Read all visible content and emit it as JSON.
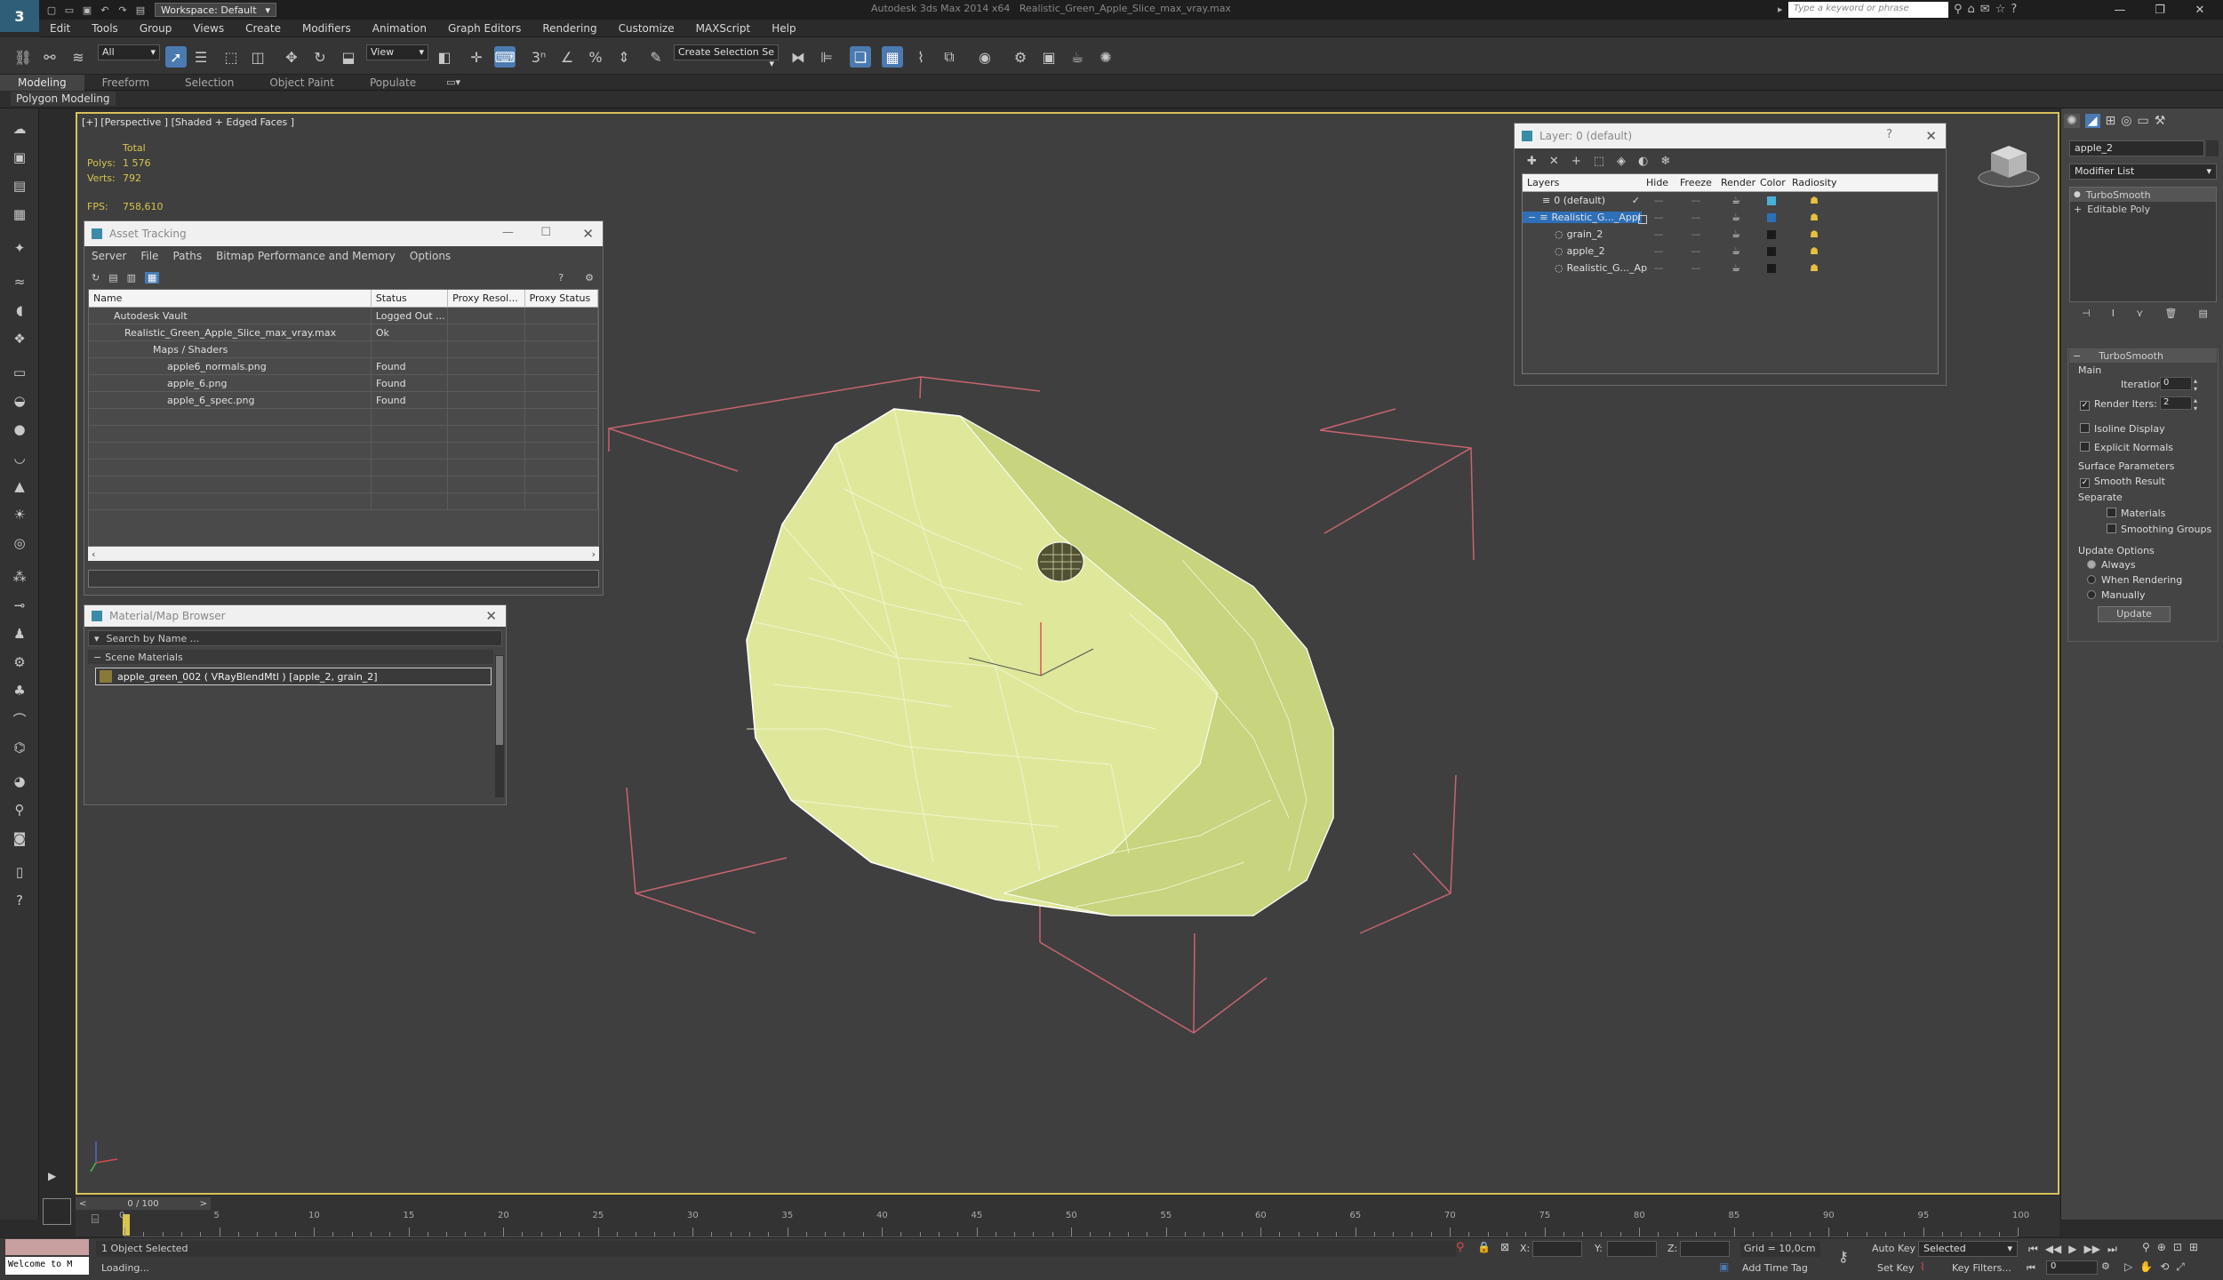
{
  "app": {
    "logo": "3",
    "workspace": "Workspace: Default",
    "title_app": "Autodesk 3ds Max  2014 x64",
    "title_file": "Realistic_Green_Apple_Slice_max_vray.max",
    "search_placeholder": "Type a keyword or phrase"
  },
  "menu": [
    "Edit",
    "Tools",
    "Group",
    "Views",
    "Create",
    "Modifiers",
    "Animation",
    "Graph Editors",
    "Rendering",
    "Customize",
    "MAXScript",
    "Help"
  ],
  "toolbar": {
    "selection_filter": "All",
    "ref_coord": "View",
    "named_selection": "Create Selection Se"
  },
  "ribbon": {
    "tabs": [
      "Modeling",
      "Freeform",
      "Selection",
      "Object Paint",
      "Populate"
    ],
    "sub": "Polygon Modeling"
  },
  "viewport": {
    "label": "[+] [Perspective ] [Shaded + Edged Faces ]",
    "stats": {
      "total": "Total",
      "polys_label": "Polys:",
      "polys": "1 576",
      "verts_label": "Verts:",
      "verts": "792",
      "fps_label": "FPS:",
      "fps": "758,610"
    }
  },
  "asset_tracking": {
    "title": "Asset Tracking",
    "menu": [
      "Server",
      "File",
      "Paths",
      "Bitmap Performance and Memory",
      "Options"
    ],
    "columns": [
      "Name",
      "Status",
      "Proxy Resol...",
      "Proxy Status"
    ],
    "rows": [
      {
        "name": "Autodesk Vault",
        "status": "Logged Out ..."
      },
      {
        "name": "Realistic_Green_Apple_Slice_max_vray.max",
        "status": "Ok"
      },
      {
        "name": "Maps / Shaders",
        "status": ""
      },
      {
        "name": "apple6_normals.png",
        "status": "Found"
      },
      {
        "name": "apple_6.png",
        "status": "Found"
      },
      {
        "name": "apple_6_spec.png",
        "status": "Found"
      }
    ]
  },
  "material_browser": {
    "title": "Material/Map Browser",
    "search_placeholder": "Search by Name ...",
    "section": "Scene Materials",
    "item": "apple_green_002  ( VRayBlendMtl ) [apple_2, grain_2]"
  },
  "layer_manager": {
    "title": "Layer: 0 (default)",
    "help": "?",
    "columns": [
      "Layers",
      "Hide",
      "Freeze",
      "Render",
      "Color",
      "Radiosity"
    ],
    "rows": [
      {
        "name": "0 (default)",
        "indent": 0,
        "color": "#4ab0d8"
      },
      {
        "name": "Realistic_G..._Appl",
        "indent": 0,
        "color": "#2d6fb8",
        "selected": true
      },
      {
        "name": "grain_2",
        "indent": 1,
        "color": "#1a1a1a"
      },
      {
        "name": "apple_2",
        "indent": 1,
        "color": "#1a1a1a"
      },
      {
        "name": "Realistic_G..._Ap",
        "indent": 1,
        "color": "#1a1a1a"
      }
    ]
  },
  "command_panel": {
    "object_name": "apple_2",
    "modifier_list": "Modifier List",
    "stack": [
      "TurboSmooth",
      "Editable Poly"
    ],
    "rollout": "TurboSmooth",
    "main": "Main",
    "iterations_label": "Iterations:",
    "iterations": "0",
    "render_iters_label": "Render Iters:",
    "render_iters": "2",
    "isoline": "Isoline Display",
    "explicit": "Explicit Normals",
    "surface": "Surface Parameters",
    "smooth": "Smooth Result",
    "separate": "Separate",
    "materials": "Materials",
    "smoothing": "Smoothing Groups",
    "update_options": "Update Options",
    "always": "Always",
    "when_rendering": "When Rendering",
    "manually": "Manually",
    "update_btn": "Update"
  },
  "timeline": {
    "frame": "0 / 100",
    "ticks": [
      "0",
      "5",
      "10",
      "15",
      "20",
      "25",
      "30",
      "35",
      "40",
      "45",
      "50",
      "55",
      "60",
      "65",
      "70",
      "75",
      "80",
      "85",
      "90",
      "95",
      "100"
    ]
  },
  "status": {
    "welcome": "Welcome to M",
    "selected": "1 Object Selected",
    "loading": "Loading...",
    "x": "X:",
    "y": "Y:",
    "z": "Z:",
    "grid": "Grid = 10,0cm",
    "add_time_tag": "Add Time Tag",
    "auto_key": "Auto Key",
    "set_key": "Set Key",
    "selected_dd": "Selected",
    "key_filters": "Key Filters...",
    "frame_val": "0"
  }
}
